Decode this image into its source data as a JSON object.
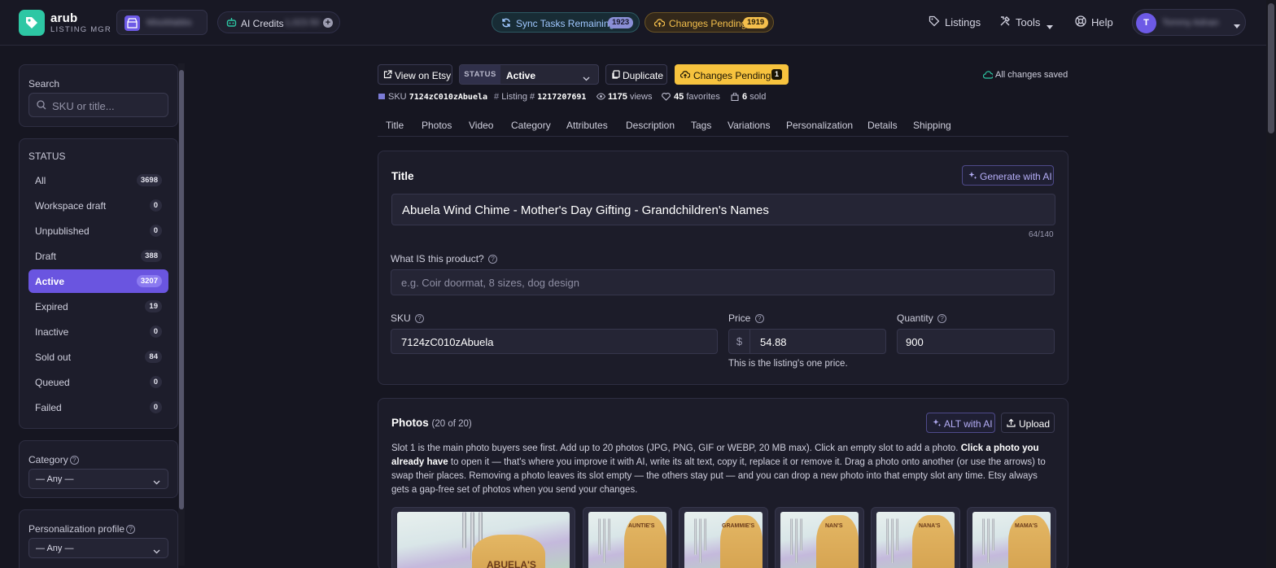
{
  "app": {
    "brand_name": "arub",
    "brand_sub": "LISTING MGR",
    "shop_name": "MissMabbs",
    "credits_label": "AI Credits",
    "credits_value": "1,023.50",
    "sync_label": "Sync Tasks Remaining",
    "sync_count": "1923",
    "pending_label": "Changes Pending",
    "pending_count": "1919",
    "nav": [
      "Listings",
      "Tools",
      "Help"
    ],
    "user_initial": "T",
    "user_name": "Tommy Adnan"
  },
  "sidebar": {
    "search_label": "Search",
    "search_placeholder": "SKU or title...",
    "status_heading": "STATUS",
    "statuses": [
      {
        "label": "All",
        "count": "3698"
      },
      {
        "label": "Workspace draft",
        "count": "0"
      },
      {
        "label": "Unpublished",
        "count": "0"
      },
      {
        "label": "Draft",
        "count": "388"
      },
      {
        "label": "Active",
        "count": "3207"
      },
      {
        "label": "Expired",
        "count": "19"
      },
      {
        "label": "Inactive",
        "count": "0"
      },
      {
        "label": "Sold out",
        "count": "84"
      },
      {
        "label": "Queued",
        "count": "0"
      },
      {
        "label": "Failed",
        "count": "0"
      }
    ],
    "active_status": "Active",
    "category_label": "Category",
    "category_value": "— Any —",
    "personalization_label": "Personalization profile",
    "personalization_value": "— Any —"
  },
  "toolbar": {
    "view_on_etsy": "View on Etsy",
    "status_tag": "STATUS",
    "status_value": "Active",
    "duplicate": "Duplicate",
    "changes_pending": "Changes Pending",
    "changes_pending_count": "1",
    "saved_text": "All changes saved"
  },
  "meta": {
    "sku_label": "SKU",
    "sku_value": "7124zC010zAbuela",
    "listing_label": "Listing #",
    "listing_value": "1217207691",
    "views_value": "1175",
    "views_label": "views",
    "favorites_value": "45",
    "favorites_label": "favorites",
    "sold_value": "6",
    "sold_label": "sold"
  },
  "tabs": [
    "Title",
    "Photos",
    "Video",
    "Category",
    "Attributes",
    "Description",
    "Tags",
    "Variations",
    "Personalization",
    "Details",
    "Shipping"
  ],
  "title_section": {
    "heading": "Title",
    "generate_ai": "Generate with AI",
    "title_value": "Abuela Wind Chime - Mother's Day Gifting - Grandchildren's Names",
    "char_count": "64/140",
    "what_label": "What IS this product?",
    "what_placeholder": "e.g. Coir doormat, 8 sizes, dog design",
    "sku_label": "SKU",
    "sku_value": "7124zC010zAbuela",
    "price_label": "Price",
    "currency": "$",
    "price_value": "54.88",
    "price_helper": "This is the listing's one price.",
    "quantity_label": "Quantity",
    "quantity_value": "900"
  },
  "photos_section": {
    "heading": "Photos",
    "count": "(20 of 20)",
    "alt_ai": "ALT with AI",
    "upload": "Upload",
    "desc_1": "Slot 1 is the main photo buyers see first. Add up to 20 photos (JPG, PNG, GIF or WEBP, 20 MB max). Click an empty slot to add a photo.",
    "desc_bold": "Click a photo you already have",
    "desc_2": "to open it — that's where you improve it with AI, write its alt text, copy it, replace it or remove it. Drag a photo onto another (or use the arrows) to swap their places. Removing a photo leaves its slot empty — the others stay put — and you can drop a new photo into that empty slot any time. Etsy always gets a gap-free set of photos when you send your changes.",
    "thumb_captions": [
      "ABUELA'S",
      "AUNTIE'S",
      "GRAMMIE'S",
      "NAN'S",
      "NANA'S",
      "MAMA'S"
    ]
  },
  "colors": {
    "accent": "#6a55e0",
    "pending": "#f7c33e",
    "teal": "#2dc7a4",
    "background": "#161621",
    "card": "#1d1d2b"
  }
}
